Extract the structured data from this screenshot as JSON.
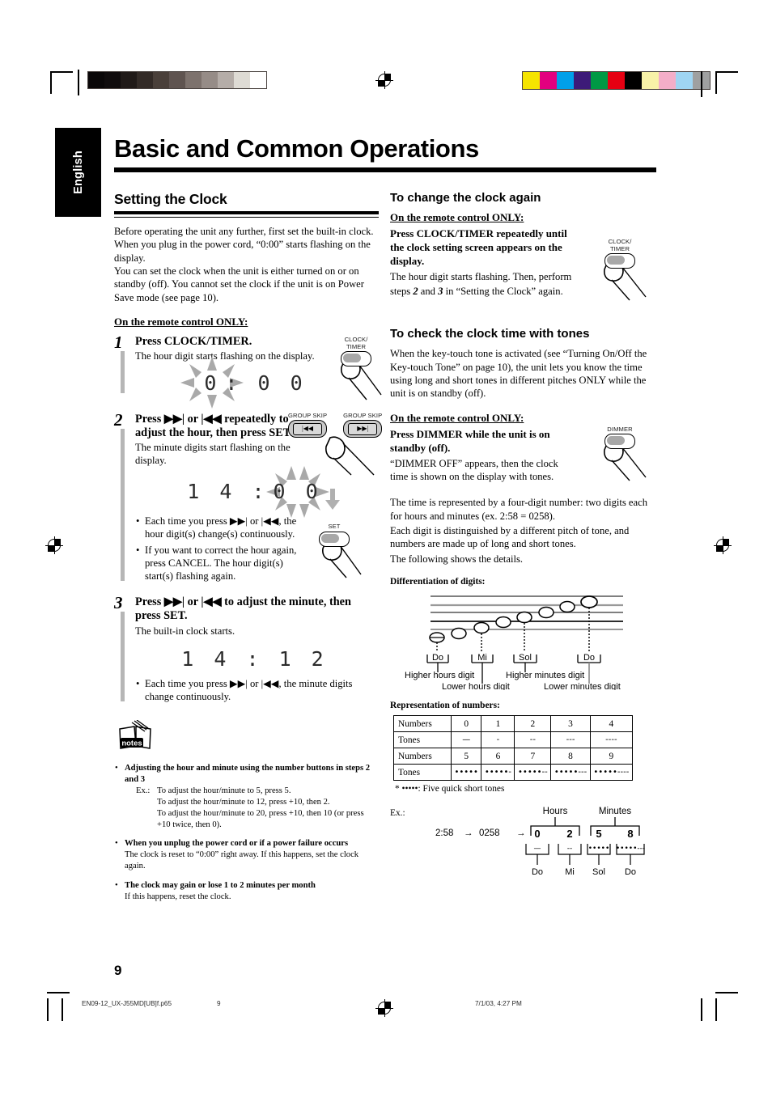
{
  "printer": {
    "gray_swatches": [
      "#0a0708",
      "#100c0d",
      "#201a18",
      "#332b27",
      "#4a403a",
      "#5f5450",
      "#7d726d",
      "#968c87",
      "#b5ada8",
      "#dedbd4",
      "#ffffff"
    ],
    "color_swatches": [
      "#f5e400",
      "#e3007f",
      "#00a0e9",
      "#3d1a78",
      "#009944",
      "#e60012",
      "#000000",
      "#f8f2a8",
      "#f4aec8",
      "#9fd5f2",
      "#9fa0a0"
    ]
  },
  "sidetab": {
    "label": "English"
  },
  "header": {
    "chapter_title": "Basic and Common Operations"
  },
  "left": {
    "section_title": "Setting the Clock",
    "intro": [
      "Before operating the unit any further, first set the built-in clock. When you plug in the power cord, “0:00” starts flashing on the display.",
      "You can set the clock when the unit is either turned on or on standby (off). You cannot set the clock if the unit is on Power Save mode (see page 10)."
    ],
    "remote_only": "On the remote control ONLY:",
    "steps": [
      {
        "num": "1",
        "title": "Press CLOCK/TIMER.",
        "desc": "The hour digit starts flashing on the display.",
        "display": {
          "flash_part": "0",
          "rest": ":  0 0"
        },
        "button_caption": "CLOCK/\nTIMER"
      },
      {
        "num": "2",
        "title_parts": [
          "Press ",
          " or ",
          " repeatedly to adjust the hour, then press SET."
        ],
        "desc": "The minute digits start flashing on the display.",
        "display": {
          "static_part": "1 4 :",
          "flash_part": "0 0"
        },
        "bullets": [
          "Each time you press ▶▶| or |◀◀, the hour digit(s) change(s) continuously.",
          "If you want to correct the hour again, press CANCEL. The hour digit(s) start(s) flashing again."
        ],
        "skip_caption_left": "GROUP SKIP",
        "skip_caption_right": "GROUP SKIP",
        "skip_glyph_left": "|◀◀",
        "skip_glyph_right": "▶▶|",
        "set_caption": "SET"
      },
      {
        "num": "3",
        "title": "Press ▶▶| or |◀◀ to adjust the minute, then press SET.",
        "desc": "The built-in clock starts.",
        "display": {
          "text": "1 4 : 1 2"
        },
        "bullets": [
          "Each time you press ▶▶| or |◀◀, the minute digits change continuously."
        ]
      }
    ],
    "notes_icon_label": "notes",
    "notes": [
      {
        "head": "Adjusting the hour and minute using the number buttons in steps 2 and 3",
        "ex_label": "Ex.:",
        "ex_lines": [
          "To adjust the hour/minute to 5, press 5.",
          "To adjust the hour/minute to 12, press +10, then 2.",
          "To adjust the hour/minute to 20, press +10, then 10 (or press +10 twice, then 0)."
        ]
      },
      {
        "head": "When you unplug the power cord or if a power failure occurs",
        "body": "The clock is reset to “0:00” right away. If this happens, set the clock again."
      },
      {
        "head": "The clock may gain or lose 1 to 2 minutes per month",
        "body": "If this happens, reset the clock."
      }
    ]
  },
  "right": {
    "sec1": {
      "title": "To change the clock again",
      "remote_only": "On the remote control ONLY:",
      "bold_lines": "Press CLOCK/TIMER repeatedly until the clock setting screen appears on the display.",
      "body_1": "The hour digit starts flashing. Then, perform",
      "body_2_pre": "steps ",
      "body_2_a": "2",
      "body_2_mid": " and ",
      "body_2_b": "3",
      "body_2_post": " in “Setting the Clock” again.",
      "button_caption": "CLOCK/\nTIMER"
    },
    "sec2": {
      "title": "To check the clock time with tones",
      "body": "When the key-touch tone is activated (see “Turning On/Off the Key-touch Tone” on page 10), the unit lets you know the time using long and short tones in different pitches ONLY while the unit is on standby (off).",
      "remote_only": "On the remote control ONLY:",
      "bold_lines": "Press DIMMER while the unit is on standby (off).",
      "body_2": "“DIMMER OFF” appears, then the clock time is shown on the display with tones.",
      "body_3": [
        "The time is represented by a four-digit number: two digits each for hours and minutes (ex. 2:58 = 0258).",
        "Each digit is distinguished by a different pitch of tone, and numbers are made up of long and short tones.",
        "The following shows the details."
      ],
      "button_caption": "DIMMER"
    },
    "diff_digits": {
      "title": "Differentiation of digits:",
      "note_labels": [
        "Do",
        "Mi",
        "Sol",
        "Do"
      ],
      "digit_labels": [
        "Higher hours digit",
        "Lower hours digit",
        "Higher minutes digit",
        "Lower minutes digit"
      ]
    },
    "numbers_table": {
      "title": "Representation of numbers:",
      "row_label_numbers": "Numbers",
      "row_label_tones": "Tones",
      "numbers_row1": [
        "0",
        "1",
        "2",
        "3",
        "4"
      ],
      "tones_row1": [
        "—",
        "-",
        "--",
        "---",
        "----"
      ],
      "numbers_row2": [
        "5",
        "6",
        "7",
        "8",
        "9"
      ],
      "tones_row2": [
        "•••••",
        "•••••-",
        "•••••--",
        "•••••---",
        "•••••----"
      ],
      "footnote": "* •••••:  Five quick short tones"
    },
    "example": {
      "label": "Ex.:",
      "time": "2:58",
      "arrow": "→",
      "digits_code": "0258",
      "group_hours": "Hours",
      "group_minutes": "Minutes",
      "digits": [
        "0",
        "2",
        "5",
        "8"
      ],
      "tones": [
        "—",
        "--",
        "•••••",
        "•••••---"
      ],
      "notes": [
        "Do",
        "Mi",
        "Sol",
        "Do"
      ]
    }
  },
  "footer": {
    "page_number": "9",
    "file_name": "EN09-12_UX-J55MD[UB]f.p65",
    "footer_page": "9",
    "date": "7/1/03, 4:27 PM"
  }
}
